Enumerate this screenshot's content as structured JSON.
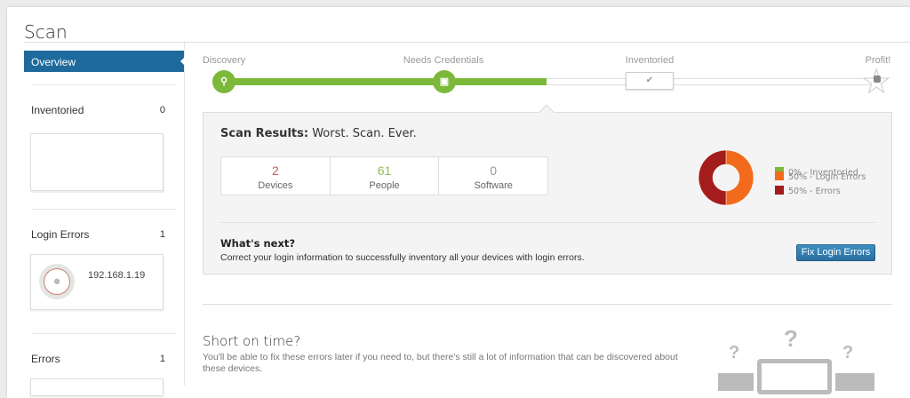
{
  "page": {
    "title": "Scan"
  },
  "sidebar": {
    "overview_label": "Overview",
    "sections": [
      {
        "label": "Inventoried",
        "count": "0"
      },
      {
        "label": "Login Errors",
        "count": "1",
        "items": [
          {
            "ip": "192.168.1.19"
          }
        ]
      },
      {
        "label": "Errors",
        "count": "1"
      }
    ]
  },
  "progress": {
    "steps": [
      {
        "label": "Discovery",
        "icon": "search-icon"
      },
      {
        "label": "Needs Credentials",
        "icon": "lock-icon"
      },
      {
        "label": "Inventoried",
        "icon": "check-icon"
      },
      {
        "label": "Profit!",
        "icon": "thumbs-up-icon"
      }
    ],
    "completed_percent": 49
  },
  "results": {
    "title_bold": "Scan Results:",
    "title_rest": "Worst. Scan. Ever.",
    "stats": [
      {
        "value": "2",
        "label": "Devices",
        "color": "#c0605a"
      },
      {
        "value": "61",
        "label": "People",
        "color": "#7cb83a"
      },
      {
        "value": "0",
        "label": "Software",
        "color": "#999999"
      }
    ],
    "legend": [
      {
        "label": "0% - Inventoried",
        "value": 0,
        "color": "#7cb83a"
      },
      {
        "label": "50% - Login Errors",
        "value": 50,
        "color": "#f26a1b"
      },
      {
        "label": "50% - Errors",
        "value": 50,
        "color": "#a51c1c"
      }
    ],
    "next_title": "What's next?",
    "next_text": "Correct your login information to successfully inventory all your devices with login errors.",
    "fix_button": "Fix Login Errors"
  },
  "short": {
    "title": "Short on time?",
    "text": "You'll be able to fix these errors later if you need to, but there's still a lot of information that can be discovered about these devices."
  }
}
